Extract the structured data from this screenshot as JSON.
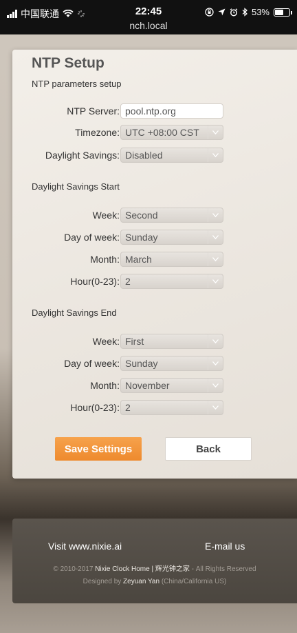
{
  "status_bar": {
    "carrier": "中国联通",
    "time": "22:45",
    "host": "nch.local",
    "battery": "53%",
    "battery_level": 0.53
  },
  "panel": {
    "title": "NTP Setup",
    "subtitle": "NTP parameters setup",
    "ntp_server": {
      "label": "NTP Server:",
      "value": "pool.ntp.org"
    },
    "timezone": {
      "label": "Timezone:",
      "value": "UTC +08:00 CST"
    },
    "daylight_savings": {
      "label": "Daylight Savings:",
      "value": "Disabled"
    },
    "dst_start": {
      "title": "Daylight Savings Start",
      "week": {
        "label": "Week:",
        "value": "Second"
      },
      "day_of_week": {
        "label": "Day of week:",
        "value": "Sunday"
      },
      "month": {
        "label": "Month:",
        "value": "March"
      },
      "hour": {
        "label": "Hour(0-23):",
        "value": "2"
      }
    },
    "dst_end": {
      "title": "Daylight Savings End",
      "week": {
        "label": "Week:",
        "value": "First"
      },
      "day_of_week": {
        "label": "Day of week:",
        "value": "Sunday"
      },
      "month": {
        "label": "Month:",
        "value": "November"
      },
      "hour": {
        "label": "Hour(0-23):",
        "value": "2"
      }
    },
    "save_label": "Save Settings",
    "back_label": "Back"
  },
  "footer": {
    "visit": "Visit www.nixie.ai",
    "email": "E-mail us",
    "copyright_prefix": "© 2010-2017",
    "copyright_name": "Nixie Clock Home | 辉光钟之家",
    "copyright_suffix": "- All Rights Reserved",
    "designed_prefix": "Designed by",
    "designed_name": "Zeyuan Yan",
    "designed_suffix": "(China/California US)"
  }
}
